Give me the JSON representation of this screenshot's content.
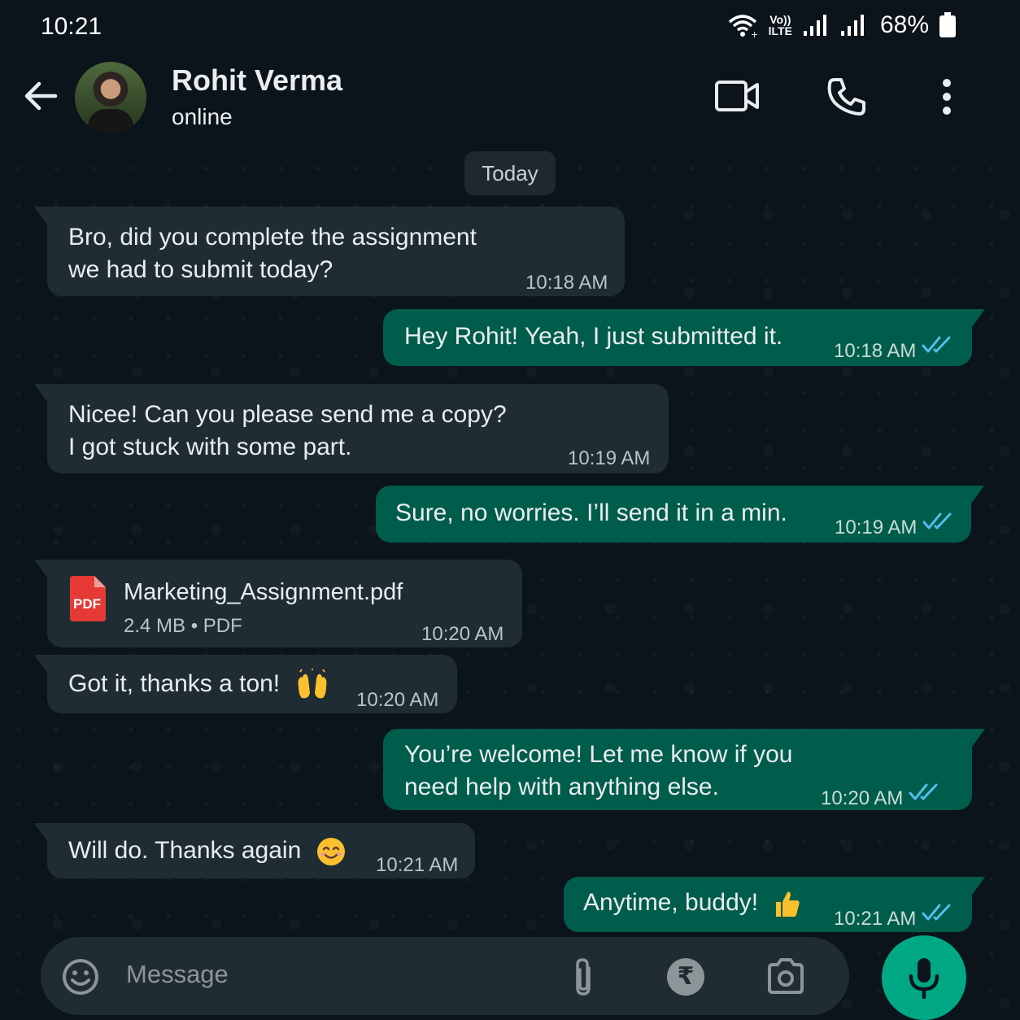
{
  "status_bar": {
    "time": "10:21",
    "lte_top": "Vo))",
    "lte_bottom": "lLTE",
    "battery": "68%"
  },
  "header": {
    "contact_name": "Rohit Verma",
    "contact_status": "online",
    "icons": [
      "back-arrow-icon",
      "video-call-icon",
      "voice-call-icon",
      "more-options-icon"
    ]
  },
  "chat": {
    "date_divider": "Today",
    "messages": [
      {
        "dir": "in",
        "line1": "Bro, did you complete the assignment",
        "line2": "we had to submit today?",
        "time": "10:18 AM"
      },
      {
        "dir": "out",
        "text": "Hey Rohit! Yeah, I just submitted it.",
        "time": "10:18 AM",
        "status": "read"
      },
      {
        "dir": "in",
        "line1": "Nicee! Can you please send me a copy?",
        "line2": "I got stuck with some part.",
        "time": "10:19 AM"
      },
      {
        "dir": "out",
        "text": "Sure, no worries. I’ll send it in a min.",
        "time": "10:19 AM",
        "status": "read"
      },
      {
        "dir": "in",
        "type": "document",
        "icon_label": "PDF",
        "file_name": "Marketing_Assignment.pdf",
        "file_meta": "2.4 MB • PDF",
        "time": "10:20 AM"
      },
      {
        "dir": "in",
        "text": "Got it, thanks a ton!",
        "emoji": "raising-hands-emoji",
        "time": "10:20 AM"
      },
      {
        "dir": "out",
        "line1": "You’re welcome! Let me know if you",
        "line2": "need help with anything else.",
        "time": "10:20 AM",
        "status": "read"
      },
      {
        "dir": "in",
        "text": "Will do. Thanks again",
        "emoji": "smiling-face-emoji",
        "time": "10:21 AM"
      },
      {
        "dir": "out",
        "text": "Anytime, buddy!",
        "emoji": "thumbs-up-emoji",
        "time": "10:21 AM",
        "status": "read"
      }
    ]
  },
  "input": {
    "placeholder": "Message",
    "currency_symbol": "₹",
    "icons": [
      "emoji-icon",
      "attach-icon",
      "rupee-payment-icon",
      "camera-icon",
      "mic-icon"
    ]
  },
  "colors": {
    "background": "#0b141a",
    "incoming_bubble": "#1f2c34",
    "outgoing_bubble": "#005c4b",
    "read_ticks": "#53bdeb",
    "mic_button": "#00a884"
  }
}
